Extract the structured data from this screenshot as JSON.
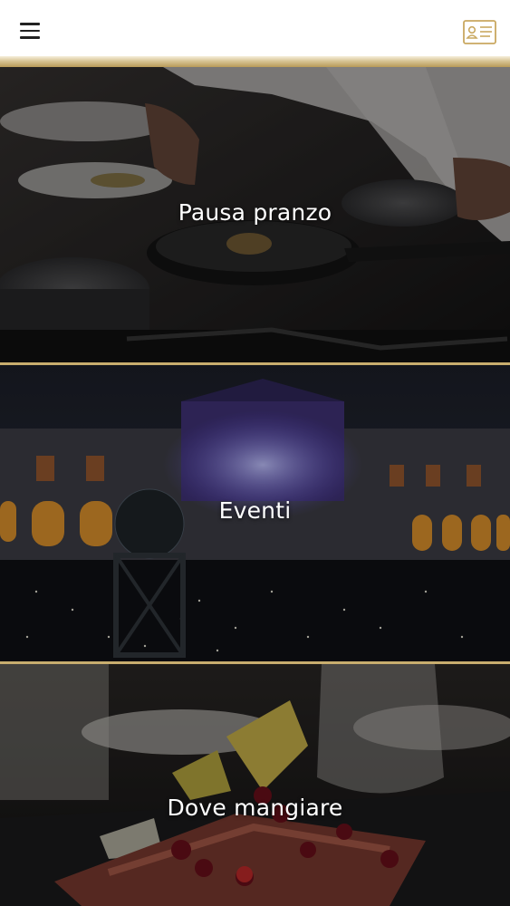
{
  "header": {
    "menu_icon": "hamburger-menu-icon",
    "card_icon": "id-card-icon",
    "accent_color": "#c9a860"
  },
  "tiles": [
    {
      "label": "Pausa pranzo",
      "image": "chef-cooking-in-kitchen"
    },
    {
      "label": "Eventi",
      "image": "palace-courtyard-at-night"
    },
    {
      "label": "Dove mangiare",
      "image": "plated-dish-on-slate"
    }
  ]
}
